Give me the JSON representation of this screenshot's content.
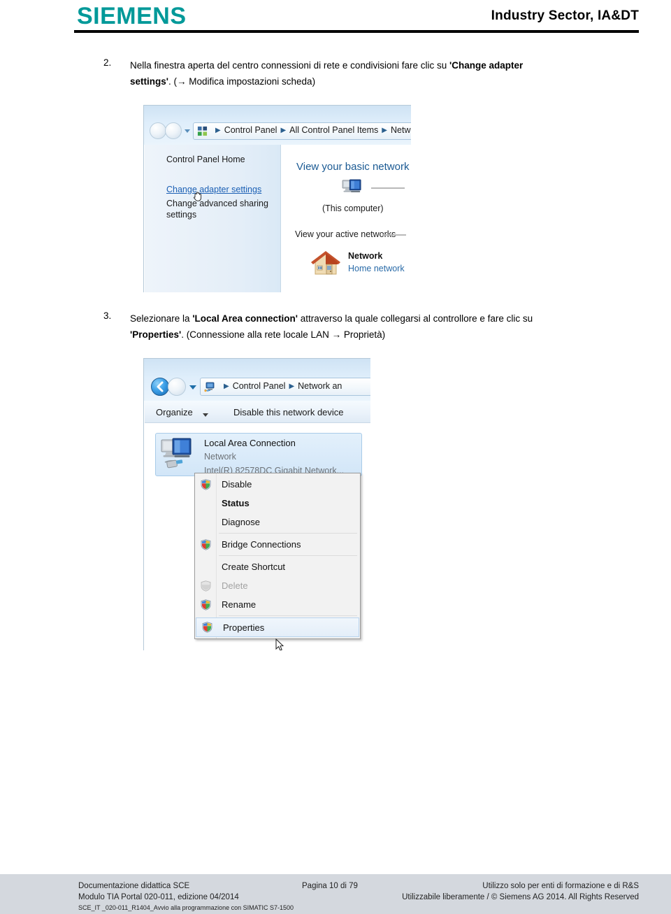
{
  "header": {
    "logo_text": "SIEMENS",
    "logo_color": "#009999",
    "right_text": "Industry Sector, IA&DT"
  },
  "steps": [
    {
      "number": "2.",
      "line1_pre": "Nella finestra aperta del centro connessioni di rete e condivisioni fare clic su ",
      "line1_bold": "'Change adapter",
      "line2_bold": "settings'",
      "line2_post": ". (→ Modifica impostazioni scheda)"
    },
    {
      "number": "3.",
      "line1_pre": "Selezionare la ",
      "line1_bold": "'Local Area connection'",
      "line1_post": " attraverso la quale collegarsi al controllore e fare clic su",
      "line2_bold": "'Properties'",
      "line2_post": ". (Connessione alla rete locale LAN → Proprietà)"
    }
  ],
  "shot1": {
    "breadcrumb": [
      "Control Panel",
      "All Control Panel Items",
      "Network"
    ],
    "sidebar": {
      "control_panel_home": "Control Panel Home",
      "change_adapter_settings": "Change adapter settings",
      "change_advanced_sharing": "Change advanced sharing settings"
    },
    "content": {
      "basic_network_title": "View your basic network",
      "this_computer": "(This computer)",
      "view_active_networks": "View your active networks",
      "network_name": "Network",
      "network_type": "Home network"
    }
  },
  "shot2": {
    "breadcrumb": [
      "Control Panel",
      "Network an"
    ],
    "toolbar": {
      "organize": "Organize",
      "disable_device": "Disable this network device"
    },
    "connection": {
      "name": "Local Area Connection",
      "status": "Network",
      "device": "Intel(R) 82578DC Gigabit Network..."
    },
    "context_menu": [
      {
        "label": "Disable",
        "shield": true,
        "bold": false,
        "disabled": false,
        "highlight": false
      },
      {
        "label": "Status",
        "shield": false,
        "bold": true,
        "disabled": false,
        "highlight": false
      },
      {
        "label": "Diagnose",
        "shield": false,
        "bold": false,
        "disabled": false,
        "highlight": false
      },
      {
        "separator": true
      },
      {
        "label": "Bridge Connections",
        "shield": true,
        "bold": false,
        "disabled": false,
        "highlight": false
      },
      {
        "separator": true
      },
      {
        "label": "Create Shortcut",
        "shield": false,
        "bold": false,
        "disabled": false,
        "highlight": false
      },
      {
        "label": "Delete",
        "shield": true,
        "shield_disabled": true,
        "bold": false,
        "disabled": true,
        "highlight": false
      },
      {
        "label": "Rename",
        "shield": true,
        "bold": false,
        "disabled": false,
        "highlight": false
      },
      {
        "separator": true
      },
      {
        "label": "Properties",
        "shield": true,
        "bold": false,
        "disabled": false,
        "highlight": true
      }
    ]
  },
  "footer": {
    "left_line1": "Documentazione didattica SCE",
    "left_line2": "Modulo TIA Portal 020-011, edizione 04/2014",
    "left_tiny": "SCE_IT _020-011_R1404_Avvio alla programmazione con SIMATIC S7-1500",
    "center_line1": "Pagina 10 di 79",
    "right_line1": "Utilizzo solo per enti di formazione e di R&S",
    "right_line2": "Utilizzabile liberamente / © Siemens AG 2014. All Rights Reserved"
  }
}
